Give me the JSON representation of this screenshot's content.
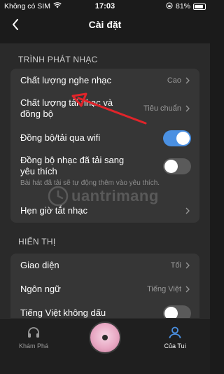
{
  "status_bar": {
    "carrier": "Không có SIM",
    "time": "17:03",
    "battery": "81%"
  },
  "header": {
    "title": "Cài đặt"
  },
  "sections": [
    {
      "title": "TRÌNH PHÁT NHẠC",
      "items": [
        {
          "label": "Chất lượng nghe nhạc",
          "value": "Cao"
        },
        {
          "label": "Chất lượng tải nhạc và đồng bộ",
          "value": "Tiêu chuẩn"
        },
        {
          "label": "Đồng bộ/tải qua wifi"
        },
        {
          "label": "Đồng bộ nhạc đã tải sang yêu thích",
          "description": "Bài hát đã tải sẽ tự động thêm vào yêu thích."
        },
        {
          "label": "Hẹn giờ tắt nhạc"
        }
      ]
    },
    {
      "title": "HIỂN THỊ",
      "items": [
        {
          "label": "Giao diện",
          "value": "Tối"
        },
        {
          "label": "Ngôn ngữ",
          "value": "Tiếng Việt"
        },
        {
          "label": "Tiếng Việt không dấu"
        }
      ]
    }
  ],
  "toggles": {
    "wifi_sync": true,
    "sync_to_favorites": false,
    "no_diacritics": false
  },
  "watermark": {
    "text": "uantrimang"
  },
  "bottom_nav": {
    "items": [
      {
        "label": "Khám Phá",
        "icon": "headphones-icon",
        "active": false
      },
      {
        "label": "Của Tui",
        "icon": "user-icon",
        "active": true
      }
    ]
  },
  "colors": {
    "accent": "#4a90e2",
    "annotation": "#e0242a"
  }
}
